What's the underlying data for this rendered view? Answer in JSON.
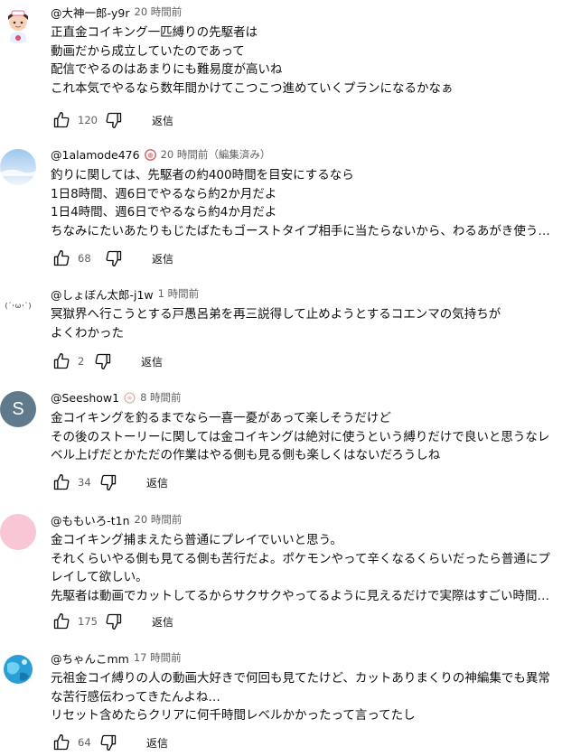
{
  "reply_label": "返信",
  "comments": [
    {
      "author": "@大神一郎-y9r",
      "time": "20 時間前",
      "lines": [
        "正直金コイキング一匹縛りの先駆者は",
        "動画だから成立していたのであって",
        "配信でやるのはあまりにも難易度が高いね",
        "これ本気でやるなら数年間かけてこつこつ進めていくプランになるかなぁ"
      ],
      "likes": "120",
      "avatar_icon": "doctor-character-icon"
    },
    {
      "author": "@1alamode476",
      "time": "20 時間前（編集済み）",
      "lines": [
        "釣りに関しては、先駆者の約400時間を目安にするなら",
        "1日8時間、週6日でやるなら約2か月だよ",
        "1日4時間、週6日でやるなら約4か月だよ",
        "ちなみにたいあたりもじたばたもゴーストタイプ相手に当たらないから、わるあがき使う…"
      ],
      "likes": "68",
      "avatar_icon": "sky-photo-icon"
    },
    {
      "author": "@しょぼん太郎-j1w",
      "time": "1 時間前",
      "lines": [
        "冥獄界へ行こうとする戸愚呂弟を再三説得して止めようとするコエンマの気持ちがよくわかった"
      ],
      "likes": "2",
      "avatar_text": "(´･ω･`)"
    },
    {
      "author": "@Seeshow1",
      "time": "8 時間前",
      "lines": [
        "金コイキングを釣るまでなら一喜一憂があって楽しそうだけど",
        "その後のストーリーに関しては金コイキングは絶対に使うという縛りだけで良いと思うなレベル上げだとかただの作業はやる側も見る側も楽しくはないだろうしね"
      ],
      "likes": "34",
      "avatar_letter": "S"
    },
    {
      "author": "@ももいろ-t1n",
      "time": "20 時間前",
      "lines": [
        "金コイキング捕まえたら普通にプレイでいいと思う。",
        "それくらいやる側も見てる側も苦行だよ。ポケモンやって辛くなるくらいだったら普通にプレイして欲しい。",
        "先駆者は動画でカットしてるからサクサクやってるように見えるだけで実際はすごい時間…"
      ],
      "likes": "175",
      "avatar_icon": "pink-circle-icon"
    },
    {
      "author": "@ちゃんこmm",
      "time": "17 時間前",
      "lines": [
        "元祖金コイ縛りの人の動画大好きで何回も見てたけど、カットありまくりの神編集でも異常な苦行感伝わってきたんよね…",
        "リセット含めたらクリアに何千時間レベルかかったって言ってたし"
      ],
      "likes": "64",
      "avatar_icon": "blue-globe-icon"
    }
  ],
  "colors": {
    "text": "#0f0f0f",
    "secondary": "#606060",
    "avatar_s": "#5f7a8a",
    "avatar_pink": "#f8c6d4"
  }
}
